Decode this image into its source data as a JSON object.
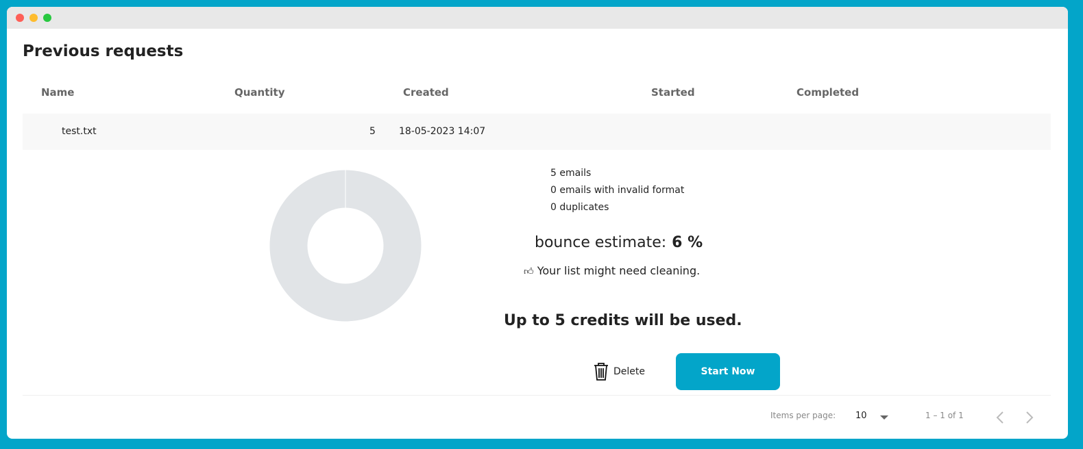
{
  "window": {
    "controls": [
      "close",
      "minimize",
      "maximize"
    ]
  },
  "page_title": "Previous requests",
  "table": {
    "columns": [
      "Name",
      "Quantity",
      "Created",
      "Started",
      "Completed"
    ],
    "rows": [
      {
        "name": "test.txt",
        "quantity": "5",
        "created": "18-05-2023 14:07",
        "started": "",
        "completed": ""
      }
    ]
  },
  "details": {
    "emails": "5 emails",
    "invalid": "0 emails with invalid format",
    "duplicates": "0 duplicates",
    "bounce_label": "bounce estimate:",
    "bounce_value": "6 %",
    "hint": "Your list might need cleaning.",
    "credits": "Up to 5 credits will be used.",
    "delete_label": "Delete",
    "start_label": "Start Now",
    "donut": {
      "color": "#e1e4e7",
      "slices": [
        100
      ]
    }
  },
  "pagination": {
    "items_per_page_label": "Items per page:",
    "items_per_page": "10",
    "range": "1 – 1 of 1"
  },
  "colors": {
    "accent": "#03a5c9"
  }
}
